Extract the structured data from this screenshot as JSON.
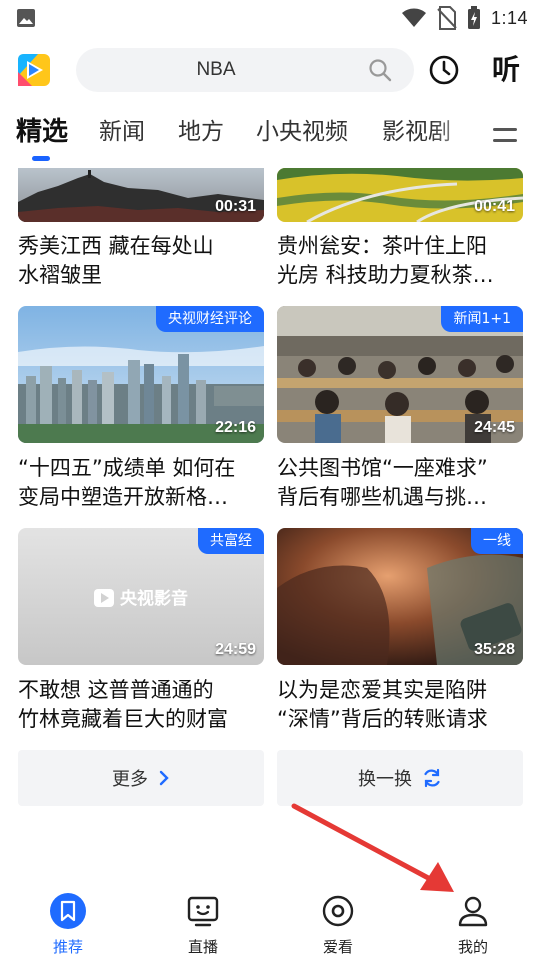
{
  "status_bar": {
    "time": "1:14",
    "icons": [
      "image-icon",
      "wifi-icon",
      "no-sim-icon",
      "battery-charging-icon"
    ]
  },
  "header": {
    "logo": "cctv-video-logo",
    "search_text": "NBA",
    "search_icon": "search-icon",
    "history_icon": "clock-icon",
    "listen_label": "听"
  },
  "tabs": {
    "items": [
      {
        "label": "精选",
        "active": true
      },
      {
        "label": "新闻",
        "active": false
      },
      {
        "label": "地方",
        "active": false
      },
      {
        "label": "小央视频",
        "active": false
      },
      {
        "label": "影视剧",
        "active": false
      }
    ],
    "menu_icon": "menu-icon"
  },
  "cards": [
    {
      "duration": "00:31",
      "badge": "",
      "title_line1": "秀美江西 藏在每处山",
      "title_line2": "水褶皱里"
    },
    {
      "duration": "00:41",
      "badge": "",
      "title_line1": "贵州瓮安：茶叶住上阳",
      "title_line2": "光房 科技助力夏秋茶…"
    },
    {
      "duration": "22:16",
      "badge": "央视财经评论",
      "title_line1": "“十四五”成绩单 如何在",
      "title_line2": "变局中塑造开放新格…"
    },
    {
      "duration": "24:45",
      "badge": "新闻1+1",
      "title_line1": "公共图书馆“一座难求”",
      "title_line2": "背后有哪些机遇与挑…"
    },
    {
      "duration": "24:59",
      "badge": "共富经",
      "placeholder_text": "央视影音",
      "title_line1": "不敢想 这普普通通的",
      "title_line2": "竹林竟藏着巨大的财富"
    },
    {
      "duration": "35:28",
      "badge": "一线",
      "title_line1": "以为是恋爱其实是陷阱",
      "title_line2": "“深情”背后的转账请求"
    }
  ],
  "buttons": {
    "more_label": "更多",
    "refresh_label": "换一换"
  },
  "bottom_nav": [
    {
      "label": "推荐",
      "icon": "bookmark-icon",
      "active": true
    },
    {
      "label": "直播",
      "icon": "tv-face-icon",
      "active": false
    },
    {
      "label": "爱看",
      "icon": "target-icon",
      "active": false
    },
    {
      "label": "我的",
      "icon": "person-icon",
      "active": false
    }
  ],
  "colors": {
    "accent": "#1f6bff",
    "annotation_arrow": "#e53935"
  }
}
